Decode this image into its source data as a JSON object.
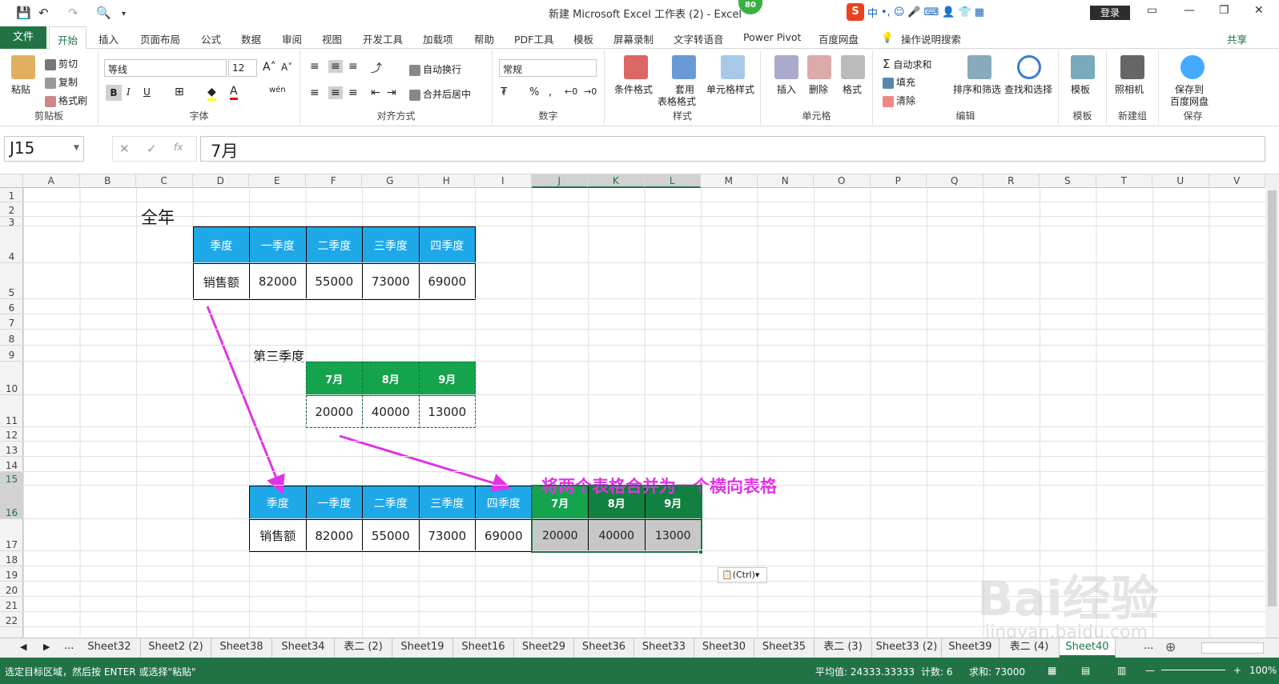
{
  "window": {
    "title": "新建 Microsoft Excel 工作表 (2)  -  Excel",
    "login": "登录",
    "badge": "80"
  },
  "ime": {
    "mode": "中",
    "icons": [
      "•,",
      "☺",
      "🎤",
      "⌨",
      "👤",
      "👕",
      "▦"
    ]
  },
  "menu": {
    "file": "文件",
    "tabs": [
      "开始",
      "插入",
      "页面布局",
      "公式",
      "数据",
      "审阅",
      "视图",
      "开发工具",
      "加载项",
      "帮助",
      "PDF工具",
      "模板",
      "屏幕录制",
      "文字转语音",
      "Power Pivot",
      "百度网盘",
      "操作说明搜索"
    ],
    "share": "共享"
  },
  "ribbon": {
    "clipboard": {
      "label": "剪贴板",
      "paste": "粘贴",
      "cut": "剪切",
      "copy": "复制",
      "format_painter": "格式刷"
    },
    "font": {
      "label": "字体",
      "font_name": "等线",
      "font_size": "12",
      "bold": "B",
      "italic": "I",
      "underline": "U",
      "wen": "wén"
    },
    "align": {
      "label": "对齐方式",
      "wrap": "自动换行",
      "merge": "合并后居中"
    },
    "number": {
      "label": "数字",
      "format": "常规",
      "percent": "%"
    },
    "styles": {
      "label": "样式",
      "cond": "条件格式",
      "table1": "套用",
      "table2": "表格格式",
      "cell_style": "单元格样式"
    },
    "cells": {
      "label": "单元格",
      "insert": "插入",
      "delete": "删除",
      "format": "格式"
    },
    "edit": {
      "label": "编辑",
      "autosum": "自动求和",
      "fill": "填充",
      "clear": "清除",
      "sort": "排序和筛选",
      "find": "查找和选择"
    },
    "template": {
      "label": "模板",
      "btn": "模板"
    },
    "newgroup": {
      "label": "新建组",
      "btn": "照相机"
    },
    "save": {
      "label": "保存",
      "btn1": "保存到",
      "btn2": "百度网盘"
    }
  },
  "formula": {
    "namebox": "J15",
    "fx": "fx",
    "value": "7月"
  },
  "columns": [
    "A",
    "B",
    "C",
    "D",
    "E",
    "F",
    "G",
    "H",
    "I",
    "J",
    "K",
    "L",
    "M",
    "N",
    "O",
    "P",
    "Q",
    "R",
    "S",
    "T",
    "U",
    "V"
  ],
  "rows": [
    "1",
    "2",
    "3",
    "4",
    "5",
    "6",
    "7",
    "8",
    "9",
    "10",
    "11",
    "12",
    "13",
    "14",
    "15",
    "16",
    "17",
    "18",
    "19",
    "20",
    "21",
    "22"
  ],
  "sheet": {
    "label_year": "全年",
    "label_q3": "第三季度",
    "table1": {
      "header": [
        "季度",
        "一季度",
        "二季度",
        "三季度",
        "四季度"
      ],
      "row": [
        "销售额",
        "82000",
        "55000",
        "73000",
        "69000"
      ]
    },
    "table2": {
      "header": [
        "7月",
        "8月",
        "9月"
      ],
      "row": [
        "20000",
        "40000",
        "13000"
      ]
    },
    "table3": {
      "header": [
        "季度",
        "一季度",
        "二季度",
        "三季度",
        "四季度",
        "7月",
        "8月",
        "9月"
      ],
      "row": [
        "销售额",
        "82000",
        "55000",
        "73000",
        "69000",
        "20000",
        "40000",
        "13000"
      ]
    },
    "annotation": "将两个表格合并为一个横向表格",
    "paste_options": "(Ctrl)"
  },
  "sheets": [
    "Sheet32",
    "Sheet2 (2)",
    "Sheet38",
    "Sheet34",
    "表二 (2)",
    "Sheet19",
    "Sheet16",
    "Sheet29",
    "Sheet36",
    "Sheet33",
    "Sheet30",
    "Sheet35",
    "表二 (3)",
    "Sheet33 (2)",
    "Sheet39",
    "表二 (4)",
    "Sheet40"
  ],
  "status": {
    "msg": "选定目标区域，然后按 ENTER 或选择\"粘贴\"",
    "avg": "平均值: 24333.33333",
    "count": "计数: 6",
    "sum": "求和: 73000",
    "zoom": "100%"
  },
  "watermark": {
    "logo": "Bai经验",
    "url": "jingyan.baidu.com"
  },
  "colors": {
    "excel_green": "#217346",
    "blue_header": "#1ea8e8",
    "green_header": "#14a44d",
    "annotation": "#e033e6"
  }
}
